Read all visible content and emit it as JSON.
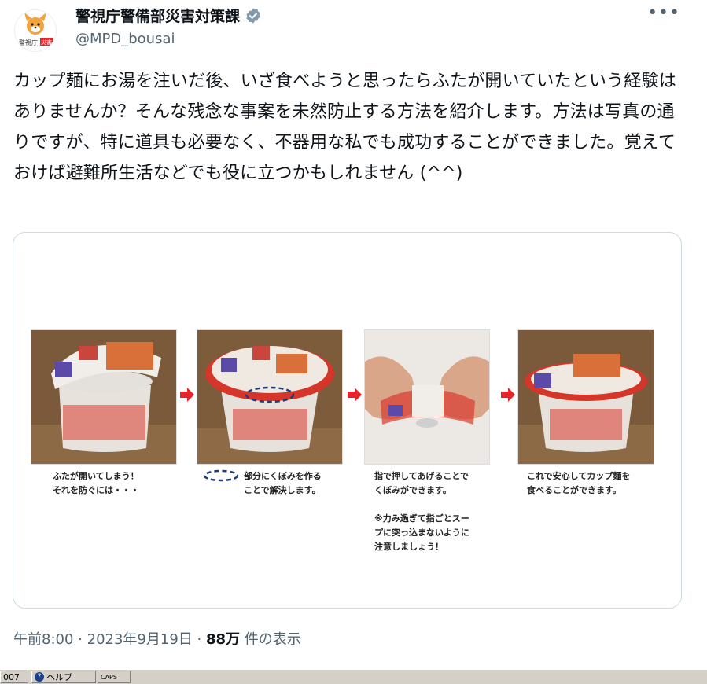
{
  "account": {
    "display_name": "警視庁警備部災害対策課",
    "handle": "@MPD_bousai",
    "avatar_label": "警視庁",
    "avatar_badge": "災害",
    "more_label": "•••"
  },
  "tweet": {
    "text": "カップ麺にお湯を注いだ後、いざ食べようと思ったらふたが開いていたという経験はありませんか？そんな残念な事案を未然防止する方法を紹介します。方法は写真の通りですが、特に道具も必要なく、不器用な私でも成功することができました。覚えておけば避難所生活などでも役に立つかもしれません (^^)"
  },
  "media": {
    "steps": [
      {
        "caption": "ふたが開いてしまう！\nそれを防ぐには・・・"
      },
      {
        "caption": "部分にくぼみを作る\nことで解決します。"
      },
      {
        "caption": "指で押してあげることで\nくぼみができます。\n\n※力み過ぎて指ごとスー\nプに突っ込まないように\n注意しましょう！"
      },
      {
        "caption": "これで安心してカップ麺を\n食べることができます。"
      }
    ]
  },
  "footer": {
    "time": "午前8:00",
    "date": "2023年9月19日",
    "views_count": "88万",
    "views_label": "件の表示",
    "sep": "·"
  },
  "taskbar": {
    "left_text": "007",
    "help_label": "ヘルプ",
    "caps_label": "CAPS"
  },
  "colors": {
    "text": "#0f1419",
    "secondary": "#536471",
    "verified": "#829aab",
    "arrow": "#e8232a",
    "dashed_oval": "#1f3d7a"
  }
}
